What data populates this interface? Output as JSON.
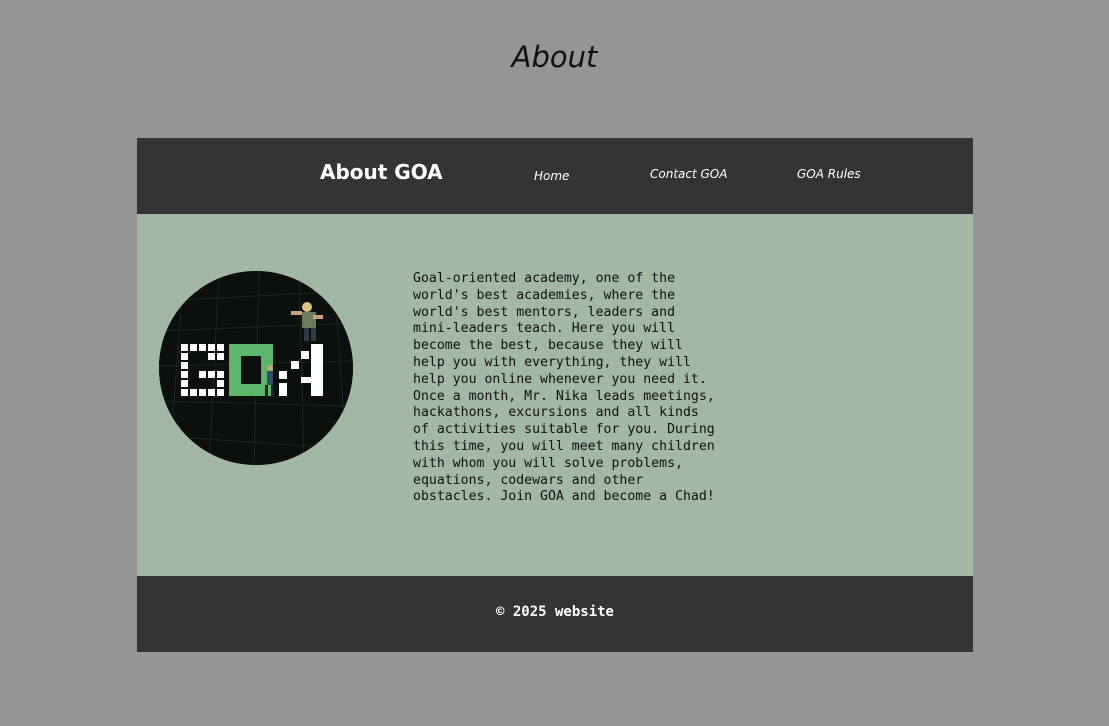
{
  "page": {
    "heading": "About"
  },
  "header": {
    "brand": "About GOA",
    "nav": [
      {
        "label": "Home"
      },
      {
        "label": "Contact GOA"
      },
      {
        "label": "GOA Rules"
      }
    ]
  },
  "main": {
    "logo": {
      "icon": "goa-logo",
      "text": "GOA"
    },
    "about_text": "Goal-oriented academy, one of the\nworld's best academies, where the\nworld's best mentors, leaders and\nmini-leaders teach. Here you will\nbecome the best, because they will\nhelp you with everything, they will\nhelp you online whenever you need it.\nOnce a month, Mr. Nika leads meetings,\nhackathons, excursions and all kinds\nof activities suitable for you. During\nthis time, you will meet many children\nwith whom you will solve problems,\nequations, codewars and other\nobstacles. Join GOA and become a Chad!"
  },
  "footer": {
    "copyright": "© 2025 website"
  },
  "colors": {
    "background": "#959595",
    "bars": "#343434",
    "content": "#a1b8a5",
    "accent_green": "#5cb66a"
  }
}
